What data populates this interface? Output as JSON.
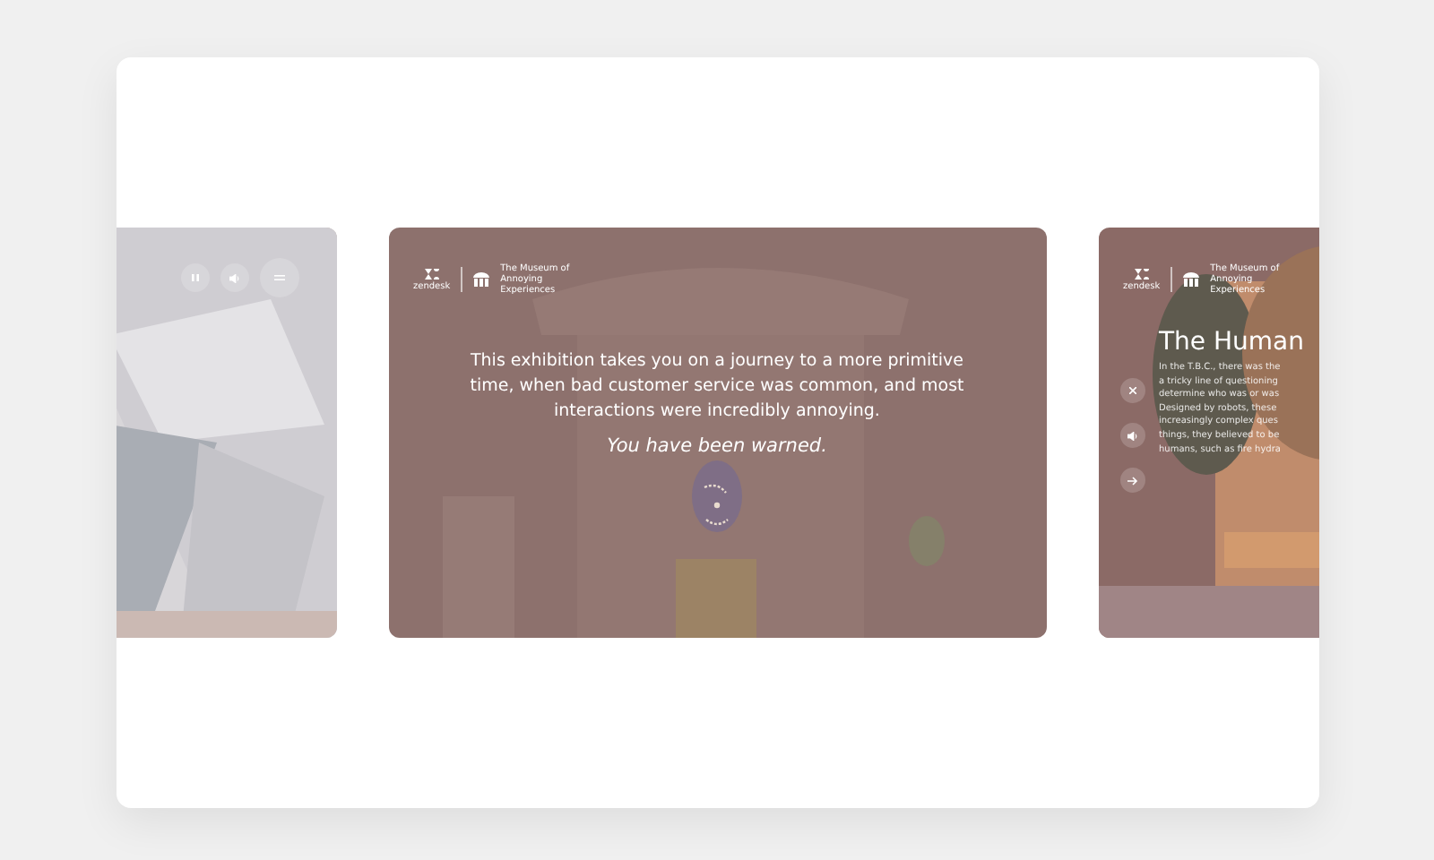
{
  "slides": [
    {
      "kind": "controls"
    },
    {
      "kind": "intro",
      "brand": "zendesk",
      "museum": "The Museum of Annoying Experiences",
      "text": "This exhibition takes you on a journey to a more primitive time, when bad customer service was common, and most interactions were incredibly annoying.",
      "warning": "You have been warned."
    },
    {
      "kind": "exhibit",
      "brand": "zendesk",
      "museum": "The Museum of Annoying Experiences",
      "heading": "The Human",
      "lines": [
        "In the T.B.C., there was the",
        "a tricky line of questioning",
        "determine who was or was",
        "Designed by robots, these",
        "increasingly complex ques",
        "things, they believed to be",
        "humans, such as fire hydra"
      ]
    }
  ]
}
